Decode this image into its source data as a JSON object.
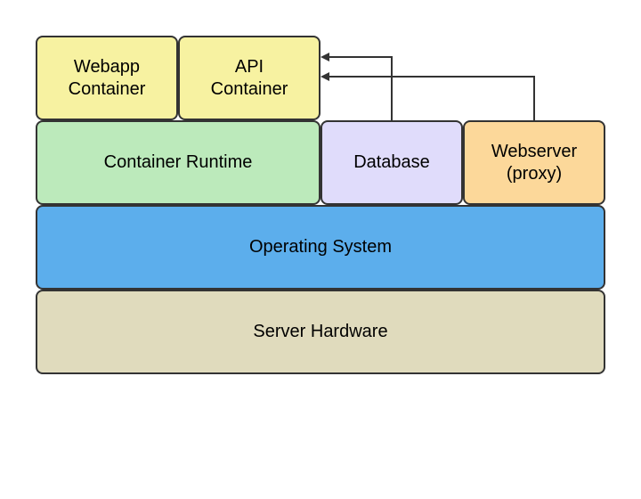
{
  "boxes": {
    "webapp": {
      "label": "Webapp\nContainer"
    },
    "api": {
      "label": "API\nContainer"
    },
    "runtime": {
      "label": "Container Runtime"
    },
    "database": {
      "label": "Database"
    },
    "webserver": {
      "label": "Webserver\n(proxy)"
    },
    "os": {
      "label": "Operating System"
    },
    "hardware": {
      "label": "Server Hardware"
    }
  },
  "colors": {
    "yellow": "#f7f2a1",
    "green": "#bceabb",
    "purple": "#e0dcfb",
    "orange": "#fcd89a",
    "blue": "#5caeec",
    "tan": "#e0dbbd",
    "stroke": "#333333"
  }
}
